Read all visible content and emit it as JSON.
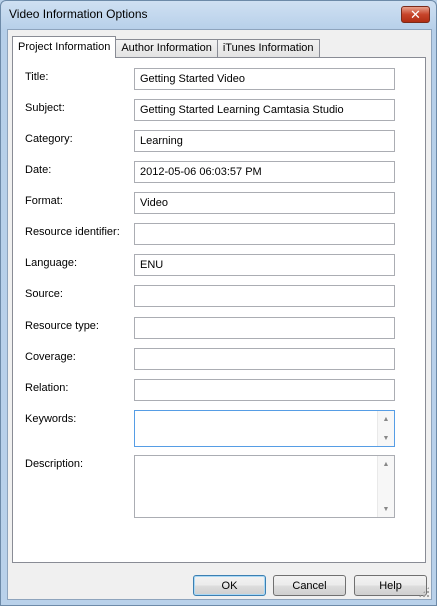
{
  "window": {
    "title": "Video Information Options",
    "close_glyph": "✕"
  },
  "tabs": [
    {
      "label": "Project Information",
      "active": true
    },
    {
      "label": "Author Information",
      "active": false
    },
    {
      "label": "iTunes Information",
      "active": false
    }
  ],
  "fields": {
    "title": {
      "label": "Title:",
      "value": "Getting Started Video"
    },
    "subject": {
      "label": "Subject:",
      "value": "Getting Started Learning Camtasia Studio"
    },
    "category": {
      "label": "Category:",
      "value": "Learning"
    },
    "date": {
      "label": "Date:",
      "value": "2012-05-06 06:03:57 PM"
    },
    "format": {
      "label": "Format:",
      "value": "Video"
    },
    "resource_identifier": {
      "label": "Resource identifier:",
      "value": ""
    },
    "language": {
      "label": "Language:",
      "value": "ENU"
    },
    "source": {
      "label": "Source:",
      "value": ""
    },
    "resource_type": {
      "label": "Resource type:",
      "value": ""
    },
    "coverage": {
      "label": "Coverage:",
      "value": ""
    },
    "relation": {
      "label": "Relation:",
      "value": ""
    },
    "keywords": {
      "label": "Keywords:",
      "value": ""
    },
    "description": {
      "label": "Description:",
      "value": ""
    }
  },
  "buttons": {
    "ok": "OK",
    "cancel": "Cancel",
    "help": "Help"
  },
  "icons": {
    "scroll_up": "▲",
    "scroll_down": "▼"
  }
}
